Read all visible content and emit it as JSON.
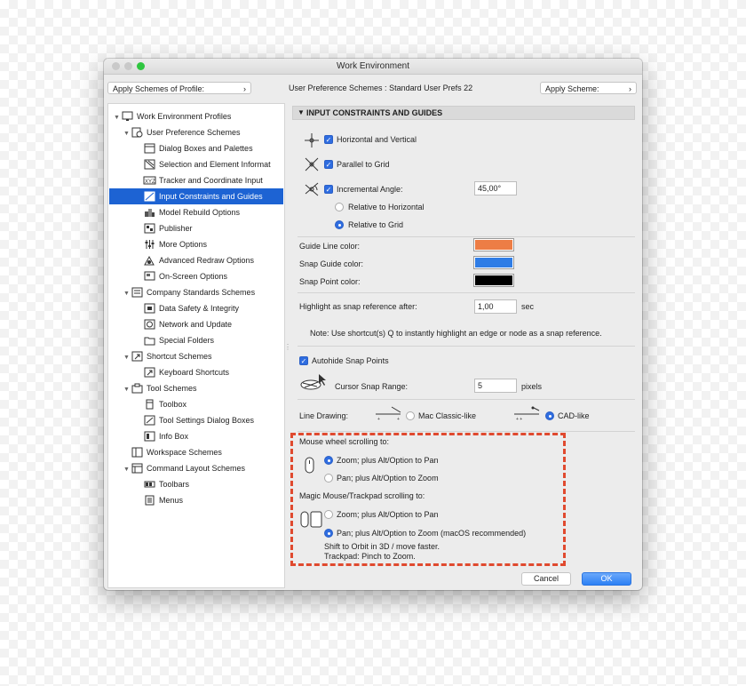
{
  "window": {
    "title": "Work Environment"
  },
  "topbar": {
    "apply_profile": "Apply Schemes of Profile:",
    "scheme_prefix": "User Preference Schemes :",
    "scheme_name": "Standard User Prefs 22",
    "apply_scheme": "Apply Scheme:"
  },
  "tree": {
    "root": "Work Environment Profiles",
    "user_pref": "User Preference Schemes",
    "dialog_boxes": "Dialog Boxes and Palettes",
    "selection": "Selection and Element Informat",
    "tracker": "Tracker and Coordinate Input",
    "input_constraints": "Input Constraints and Guides",
    "model_rebuild": "Model Rebuild Options",
    "publisher": "Publisher",
    "more_options": "More Options",
    "advanced_redraw": "Advanced Redraw Options",
    "onscreen": "On-Screen Options",
    "company": "Company Standards Schemes",
    "data_safety": "Data Safety & Integrity",
    "network": "Network and Update",
    "special_folders": "Special Folders",
    "shortcut": "Shortcut Schemes",
    "keyboard": "Keyboard Shortcuts",
    "tool_schemes": "Tool Schemes",
    "toolbox": "Toolbox",
    "tool_settings": "Tool Settings Dialog Boxes",
    "info_box": "Info Box",
    "workspace": "Workspace Schemes",
    "command_layout": "Command Layout Schemes",
    "toolbars": "Toolbars",
    "menus": "Menus"
  },
  "panel": {
    "header": "INPUT CONSTRAINTS AND GUIDES",
    "horizontal_vertical": "Horizontal and Vertical",
    "parallel_grid": "Parallel to Grid",
    "incremental_angle": "Incremental Angle:",
    "angle_value": "45,00°",
    "relative_horizontal": "Relative to Horizontal",
    "relative_grid": "Relative to Grid",
    "guide_line_color": "Guide Line color:",
    "snap_guide_color": "Snap Guide color:",
    "snap_point_color": "Snap Point color:",
    "highlight_label": "Highlight as snap reference after:",
    "highlight_value": "1,00",
    "highlight_unit": "sec",
    "note": "Note: Use shortcut(s) Q to instantly highlight an edge or node as a snap reference.",
    "autohide": "Autohide Snap Points",
    "cursor_snap_range": "Cursor Snap Range:",
    "cursor_snap_value": "5",
    "cursor_snap_unit": "pixels",
    "line_drawing": "Line Drawing:",
    "mac_classic": "Mac Classic-like",
    "cad_like": "CAD-like",
    "mouse_wheel": "Mouse wheel scrolling to:",
    "mw_zoom": "Zoom; plus Alt/Option to Pan",
    "mw_pan": "Pan; plus Alt/Option to Zoom",
    "magic_mouse": "Magic Mouse/Trackpad scrolling to:",
    "mm_zoom": "Zoom; plus Alt/Option to Pan",
    "mm_pan": "Pan; plus Alt/Option to Zoom (macOS recommended)",
    "shift_orbit": "Shift to Orbit in 3D / move faster.",
    "trackpad_pinch": "Trackpad: Pinch to Zoom."
  },
  "colors": {
    "guide_line": "#ed7d45",
    "snap_guide": "#2f7de6",
    "snap_point": "#000000",
    "selection": "#1d63d3",
    "accent": "#2f6de0",
    "highlight_box": "#e04a2f"
  },
  "buttons": {
    "cancel": "Cancel",
    "ok": "OK"
  }
}
